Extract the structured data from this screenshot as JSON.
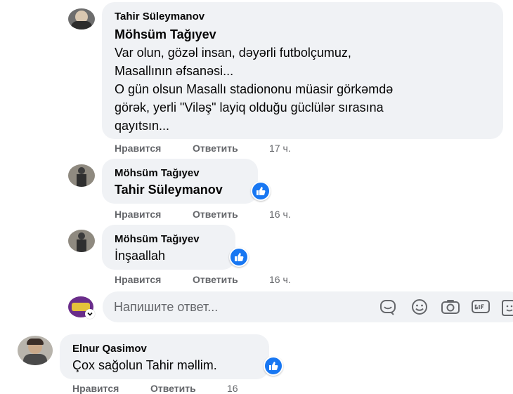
{
  "comments": [
    {
      "author": "Tahir Süleymanov",
      "mention": "Möhsüm Tağıyev",
      "lines": [
        "Var olun, gözəl insan, dəyərli futbolçumuz,",
        "Masallının əfsanəsi...",
        "O gün olsun Masallı stadiononu müasir görkəmdə",
        "görək, yerli \"Viləş\" layiq olduğu güclülər sırasına",
        "qayıtsın..."
      ],
      "like_label": "Нравится",
      "reply_label": "Ответить",
      "time": "17 ч."
    },
    {
      "author": "Möhsüm Tağıyev",
      "mention": "Tahir Süleymanov",
      "like_label": "Нравится",
      "reply_label": "Ответить",
      "time": "16 ч."
    },
    {
      "author": "Möhsüm Tağıyev",
      "text": "İnşaallah",
      "like_label": "Нравится",
      "reply_label": "Ответить",
      "time": "16 ч."
    },
    {
      "author": "Elnur Qasimov",
      "text": "Çox sağolun Tahir məllim.",
      "like_label": "Нравится",
      "reply_label": "Ответить",
      "time": "16"
    }
  ],
  "reply_box": {
    "placeholder": "Напишите ответ..."
  },
  "colors": {
    "bubble": "#f0f2f5",
    "like_blue": "#1877f2",
    "meta_gray": "#65676b"
  },
  "icons": [
    "emoji-icon",
    "camera-icon",
    "gif-icon",
    "sticker-icon",
    "thumbs-up-icon"
  ]
}
